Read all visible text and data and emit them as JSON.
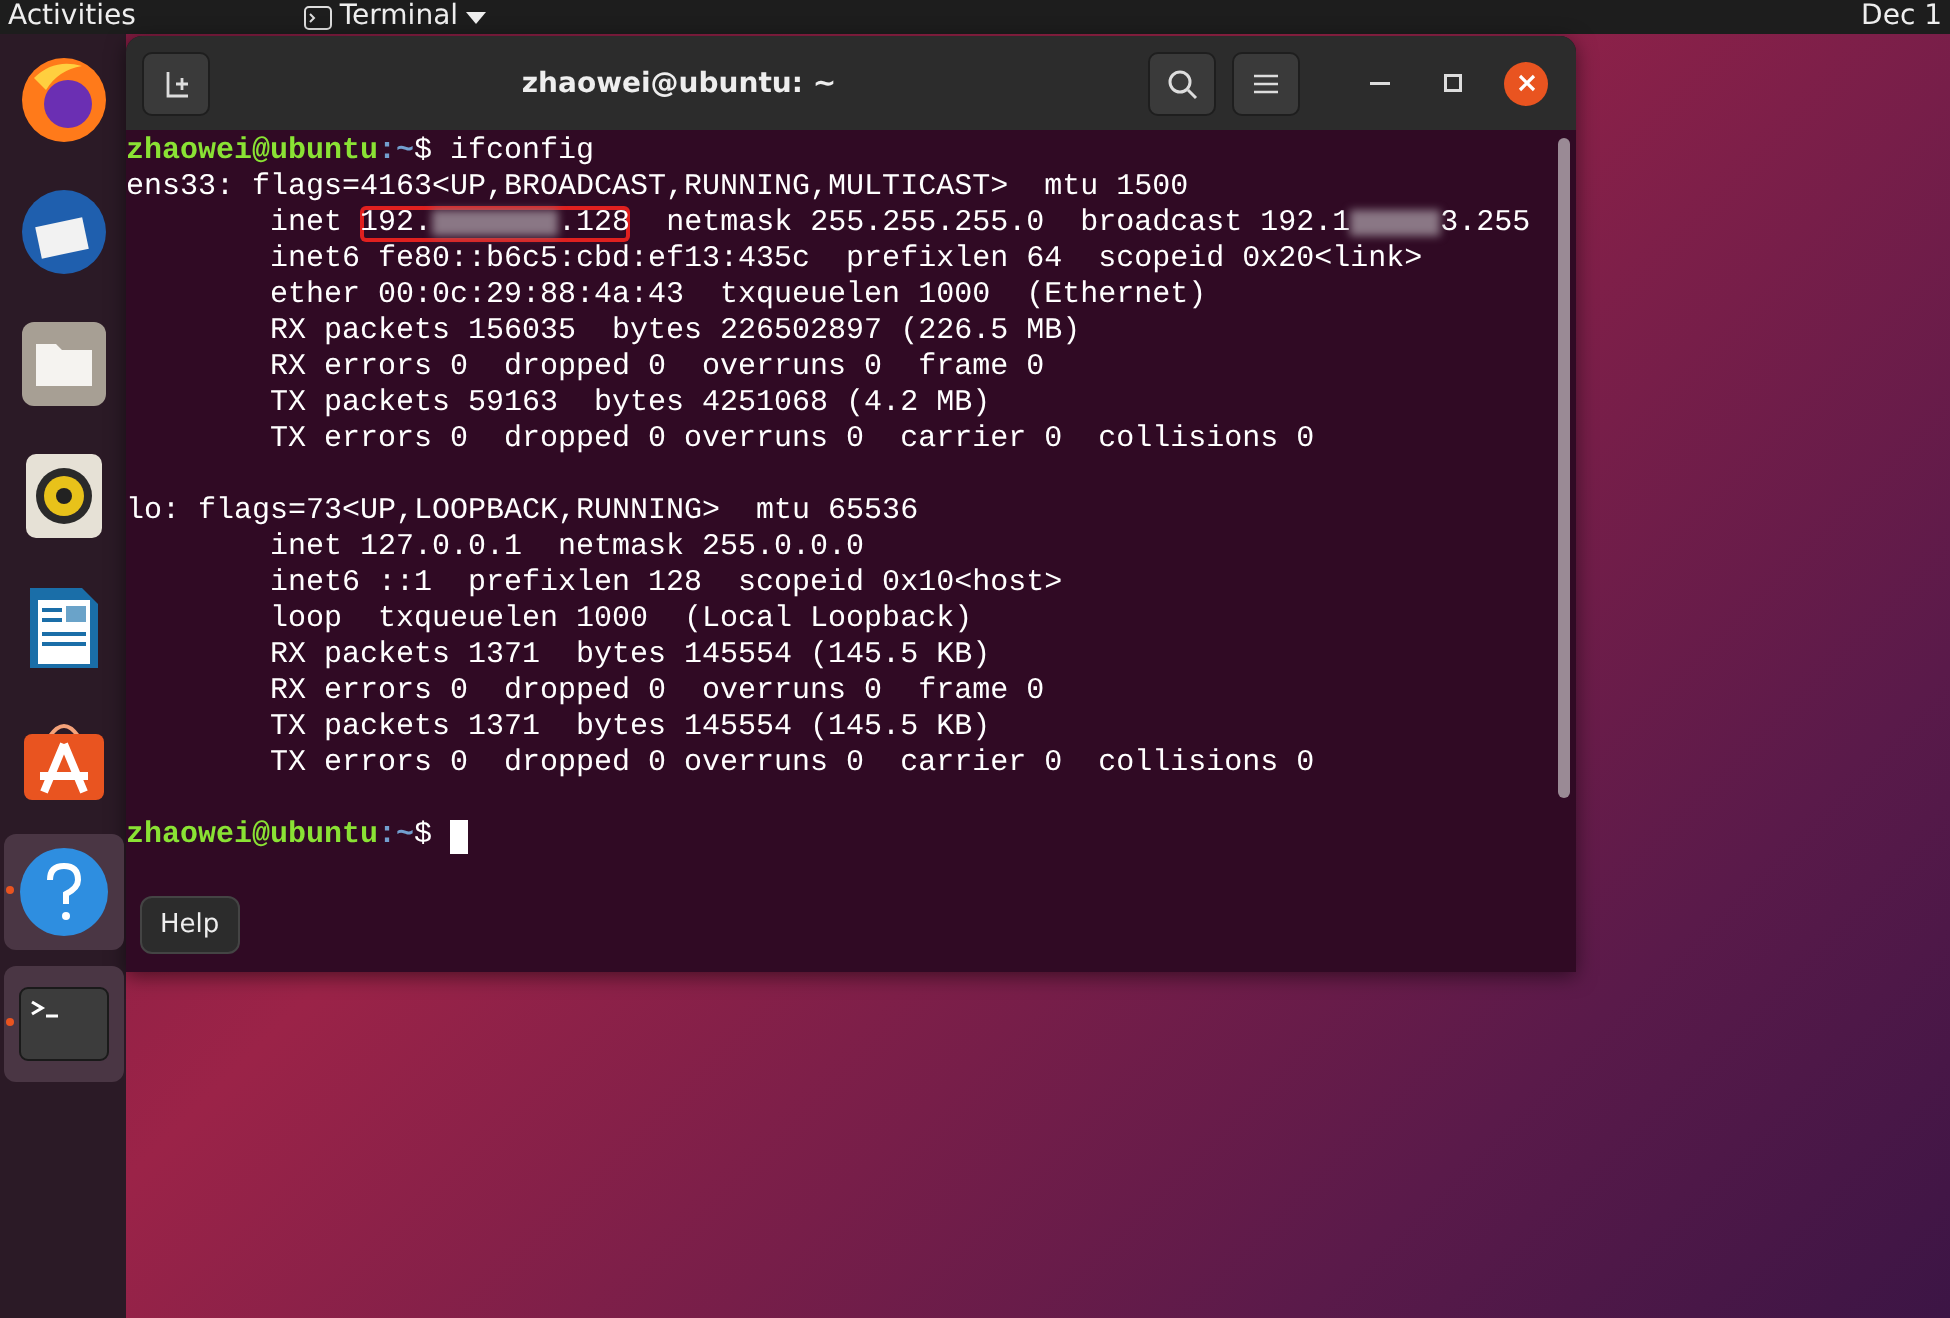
{
  "top_bar": {
    "activities": "Activities",
    "app_menu": "Terminal",
    "clock": "Dec 1"
  },
  "dock": {
    "items": [
      {
        "kind": "firefox",
        "running": false
      },
      {
        "kind": "mail",
        "running": false
      },
      {
        "kind": "files",
        "running": false
      },
      {
        "kind": "music",
        "running": false
      },
      {
        "kind": "writer",
        "running": false
      },
      {
        "kind": "store",
        "running": false
      },
      {
        "kind": "help",
        "running": true
      },
      {
        "kind": "terminal",
        "running": true
      }
    ]
  },
  "window": {
    "title": "zhaowei@ubuntu: ~",
    "blocks": [
      [
        [
          {
            "kind": "user",
            "text": "zhaowei@ubuntu"
          },
          {
            "kind": "path",
            "text": ":~"
          },
          {
            "kind": "text",
            "text": "$ ifconfig"
          }
        ],
        [
          {
            "kind": "text",
            "text": "ens33: flags=4163<UP,BROADCAST,RUNNING,MULTICAST>  mtu 1500"
          }
        ],
        [
          {
            "kind": "text",
            "text": "        inet "
          },
          {
            "kind": "marked",
            "parts": [
              {
                "kind": "text",
                "text": "192."
              },
              {
                "kind": "blur_long"
              },
              {
                "kind": "text",
                "text": ".128"
              }
            ]
          },
          {
            "kind": "text",
            "text": "  netmask 255.255.255.0  broadcast 192.1"
          },
          {
            "kind": "blur_short"
          },
          {
            "kind": "text",
            "text": "3.255"
          }
        ],
        [
          {
            "kind": "text",
            "text": "        inet6 fe80::b6c5:cbd:ef13:435c  prefixlen 64  scopeid 0x20<link>"
          }
        ],
        [
          {
            "kind": "text",
            "text": "        ether 00:0c:29:88:4a:43  txqueuelen 1000  (Ethernet)"
          }
        ],
        [
          {
            "kind": "text",
            "text": "        RX packets 156035  bytes 226502897 (226.5 MB)"
          }
        ],
        [
          {
            "kind": "text",
            "text": "        RX errors 0  dropped 0  overruns 0  frame 0"
          }
        ],
        [
          {
            "kind": "text",
            "text": "        TX packets 59163  bytes 4251068 (4.2 MB)"
          }
        ],
        [
          {
            "kind": "text",
            "text": "        TX errors 0  dropped 0 overruns 0  carrier 0  collisions 0"
          }
        ]
      ],
      [
        [
          {
            "kind": "text",
            "text": "lo: flags=73<UP,LOOPBACK,RUNNING>  mtu 65536"
          }
        ],
        [
          {
            "kind": "text",
            "text": "        inet 127.0.0.1  netmask 255.0.0.0"
          }
        ],
        [
          {
            "kind": "text",
            "text": "        inet6 ::1  prefixlen 128  scopeid 0x10<host>"
          }
        ],
        [
          {
            "kind": "text",
            "text": "        loop  txqueuelen 1000  (Local Loopback)"
          }
        ],
        [
          {
            "kind": "text",
            "text": "        RX packets 1371  bytes 145554 (145.5 KB)"
          }
        ],
        [
          {
            "kind": "text",
            "text": "        RX errors 0  dropped 0  overruns 0  frame 0"
          }
        ],
        [
          {
            "kind": "text",
            "text": "        TX packets 1371  bytes 145554 (145.5 KB)"
          }
        ],
        [
          {
            "kind": "text",
            "text": "        TX errors 0  dropped 0 overruns 0  carrier 0  collisions 0"
          }
        ]
      ],
      [
        [
          {
            "kind": "user",
            "text": "zhaowei@ubuntu"
          },
          {
            "kind": "path",
            "text": ":~"
          },
          {
            "kind": "text",
            "text": "$ "
          },
          {
            "kind": "cursor"
          }
        ]
      ]
    ]
  },
  "tooltip": {
    "text": "Help"
  }
}
